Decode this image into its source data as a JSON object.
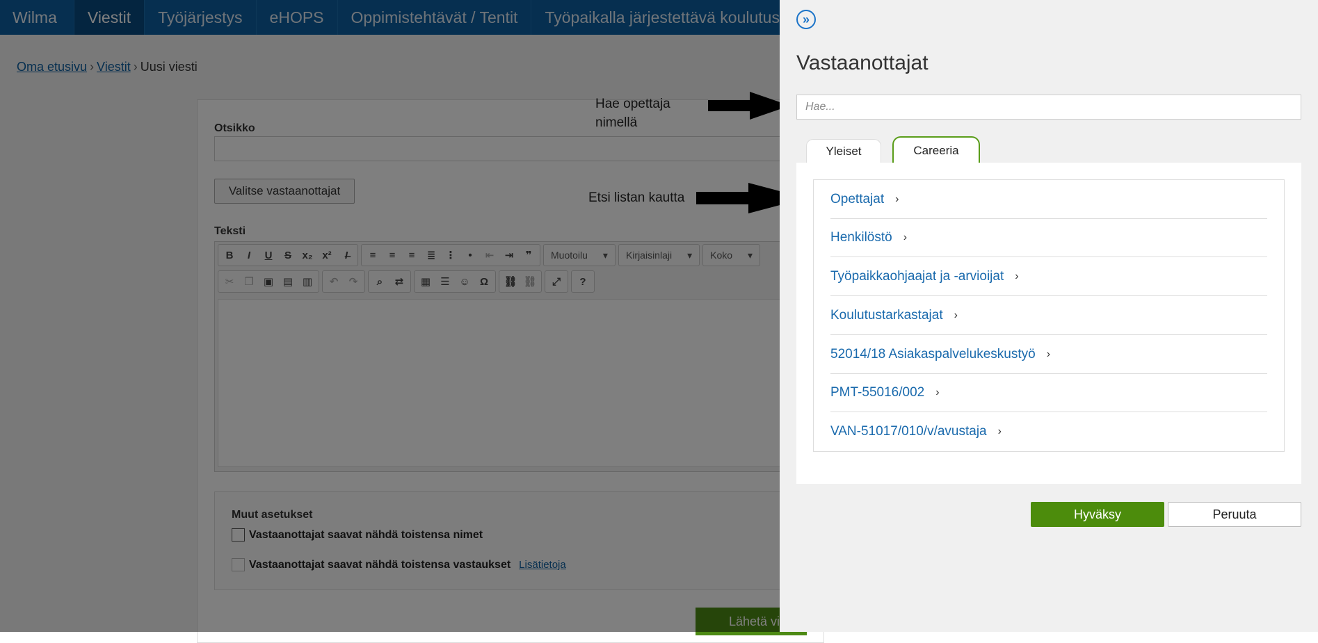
{
  "nav": {
    "brand": "Wilma",
    "items": [
      "Viestit",
      "Työjärjestys",
      "eHOPS",
      "Oppimistehtävät / Tentit",
      "Työpaikalla järjestettävä koulutus"
    ]
  },
  "breadcrumb": {
    "home": "Oma etusivu",
    "messages": "Viestit",
    "current": "Uusi viesti"
  },
  "form": {
    "subject_label": "Otsikko",
    "choose_recipients": "Valitse vastaanottajat",
    "text_label": "Teksti",
    "toolbar": {
      "format": "Muotoilu",
      "font": "Kirjaisinlaji",
      "size": "Koko"
    },
    "options": {
      "heading": "Muut asetukset",
      "see_names": "Vastaanottajat saavat nähdä toistensa nimet",
      "see_replies": "Vastaanottajat saavat nähdä toistensa vastaukset",
      "more_info": "Lisätietoja"
    },
    "send_label": "Lähetä vi"
  },
  "annotations": {
    "search_hint": "Hae opettaja nimellä",
    "list_hint": "Etsi listan kautta"
  },
  "panel": {
    "title": "Vastaanottajat",
    "search_placeholder": "Hae...",
    "tabs": [
      "Yleiset",
      "Careeria"
    ],
    "items": [
      "Opettajat",
      "Henkilöstö",
      "Työpaikkaohjaajat ja -arvioijat",
      "Koulutustarkastajat",
      "52014/18 Asiakaspalvelukeskustyö",
      "PMT-55016/002",
      "VAN-51017/010/v/avustaja"
    ],
    "accept_label": "Hyväksy",
    "cancel_label": "Peruuta"
  },
  "colors": {
    "nav": "#0d5fa0",
    "accent_green": "#4c8c0c",
    "link_blue": "#1a6aad"
  }
}
